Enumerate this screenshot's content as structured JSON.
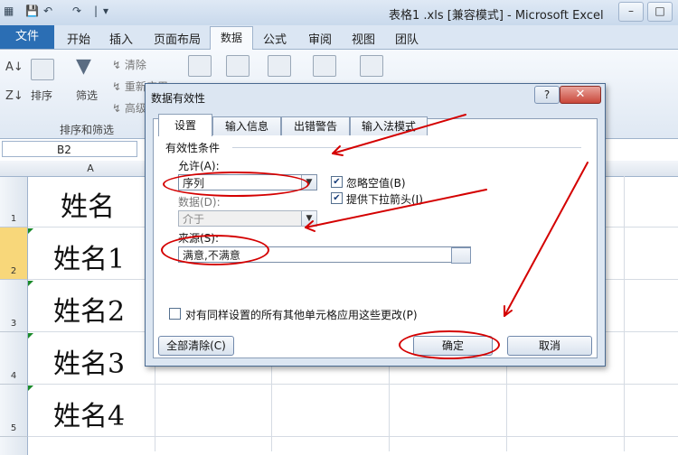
{
  "window": {
    "title": "表格1 .xls  [兼容模式]  - Microsoft Excel",
    "quick_access": [
      "💾",
      "↶",
      "↷",
      "|",
      "▾"
    ]
  },
  "ribbon": {
    "tabs": [
      "文件",
      "开始",
      "插入",
      "页面布局",
      "数据",
      "公式",
      "审阅",
      "视图",
      "团队"
    ],
    "active_tab": "数据",
    "sort_label": "排序",
    "filter_label": "筛选",
    "clear_label": "清除",
    "reapply_label": "重新应用",
    "advanced_label": "高级",
    "group_label": "排序和筛选"
  },
  "namebox": {
    "value": "B2"
  },
  "sheet": {
    "column_header": "A",
    "rows": [
      {
        "num": "1",
        "value": "姓名"
      },
      {
        "num": "2",
        "value": "姓名1"
      },
      {
        "num": "3",
        "value": "姓名2"
      },
      {
        "num": "4",
        "value": "姓名3"
      },
      {
        "num": "5",
        "value": "姓名4"
      }
    ]
  },
  "dialog": {
    "title": "数据有效性",
    "help": "?",
    "close": "✕",
    "tabs": [
      "设置",
      "输入信息",
      "出错警告",
      "输入法模式"
    ],
    "section": "有效性条件",
    "allow_label": "允许(A):",
    "allow_value": "序列",
    "data_label": "数据(D):",
    "data_value": "介于",
    "source_label": "来源(S):",
    "source_value": "满意,不满意",
    "ignore_blank": "忽略空值(B)",
    "dropdown": "提供下拉箭头(I)",
    "apply_all": "对有同样设置的所有其他单元格应用这些更改(P)",
    "clear_all": "全部清除(C)",
    "ok": "确定",
    "cancel": "取消"
  },
  "colors": {
    "annotation": "#d40000",
    "file_tab": "#2b6eb4"
  }
}
